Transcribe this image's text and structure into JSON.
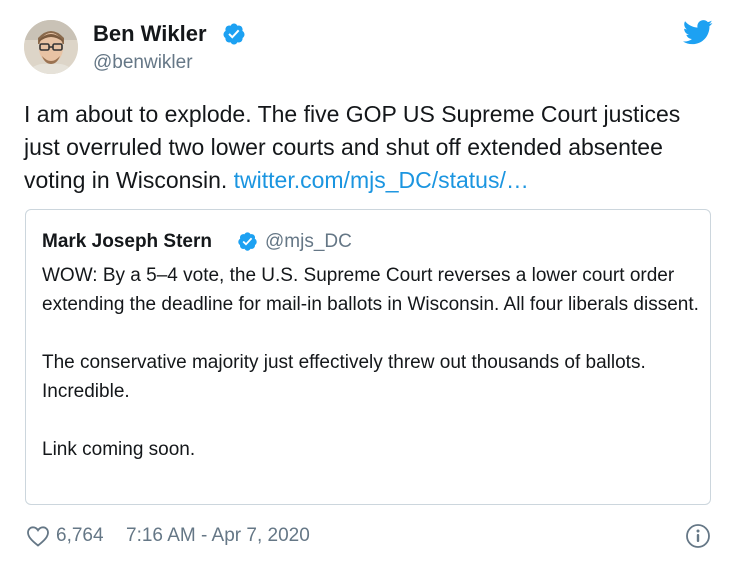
{
  "tweet": {
    "author": {
      "name": "Ben Wikler",
      "handle": "@benwikler",
      "verified": true,
      "avatar_icon": "avatar-photo"
    },
    "text": "I am about to explode. The five GOP US Supreme Court justices just overruled two lower courts and shut off extended absentee voting in Wisconsin. ",
    "link_text": "twitter.com/mjs_DC/status/…",
    "quoted": {
      "name": "Mark Joseph Stern",
      "handle": "@mjs_DC",
      "verified": true,
      "paragraphs": [
        "WOW: By a 5–4 vote, the U.S. Supreme Court reverses a lower court order extending the deadline for mail-in ballots in Wisconsin. All four liberals dissent.",
        "The conservative majority just effectively threw out thousands of ballots. Incredible.",
        "Link coming soon."
      ]
    },
    "footer": {
      "like_count": "6,764",
      "timestamp": "7:16 AM - Apr 7, 2020"
    }
  },
  "colors": {
    "brand": "#1da1f2",
    "link": "#1b95e0",
    "secondary_text": "#657786",
    "border": "#ccd6dd"
  },
  "icons": [
    "twitter-bird-icon",
    "verified-badge-icon",
    "heart-icon",
    "info-icon"
  ]
}
